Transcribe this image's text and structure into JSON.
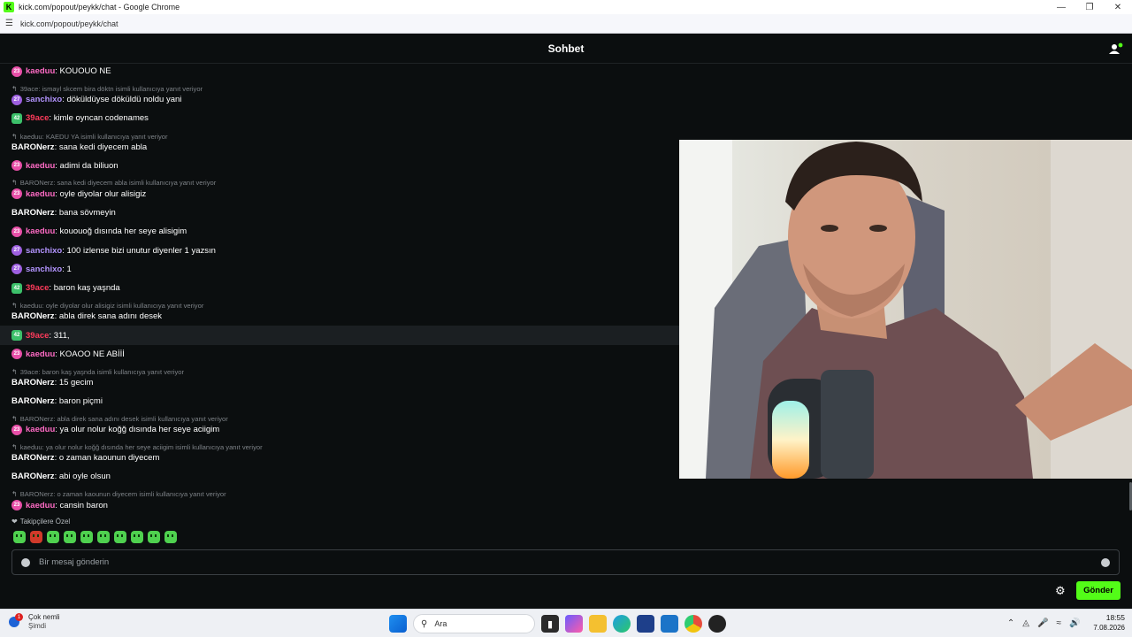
{
  "browser": {
    "window_title": "kick.com/popout/peykk/chat - Google Chrome",
    "url": "kick.com/popout/peykk/chat",
    "favicon_letter": "K"
  },
  "header": {
    "title": "Sohbet"
  },
  "messages": [
    {
      "badge": "23",
      "badge_color": "pink",
      "user": "kaeduu",
      "user_color": "pink",
      "text": ": KOUOUO NE",
      "reply": ""
    },
    {
      "badge": "27",
      "badge_color": "purple",
      "user": "sanchixo",
      "user_color": "purple",
      "text": ": döküldüyse döküldü noldu yani",
      "reply": "39ace: ismayl skcem bira döktn isimli kullanıcıya yanıt veriyor"
    },
    {
      "badge": "42",
      "badge_color": "green",
      "user": "39ace",
      "user_color": "red",
      "text": ": kimle oyncan codenames",
      "reply": ""
    },
    {
      "badge": "",
      "badge_color": "",
      "user": "BARONerz",
      "user_color": "white",
      "text": ": sana kedi diyecem abla",
      "reply": "kaeduu: KAEDU YA isimli kullanıcıya yanıt veriyor"
    },
    {
      "badge": "23",
      "badge_color": "pink",
      "user": "kaeduu",
      "user_color": "pink",
      "text": ": adimi da biliuon",
      "reply": ""
    },
    {
      "badge": "23",
      "badge_color": "pink",
      "user": "kaeduu",
      "user_color": "pink",
      "text": ": oyle diyolar olur alisigiz",
      "reply": "BARONerz: sana kedi diyecem abla isimli kullanıcıya yanıt veriyor"
    },
    {
      "badge": "",
      "badge_color": "",
      "user": "BARONerz",
      "user_color": "white",
      "text": ": bana sövmeyin",
      "reply": ""
    },
    {
      "badge": "23",
      "badge_color": "pink",
      "user": "kaeduu",
      "user_color": "pink",
      "text": ": kououoğ dısında her seye alisigim",
      "reply": ""
    },
    {
      "badge": "27",
      "badge_color": "purple",
      "user": "sanchixo",
      "user_color": "purple",
      "text": ": 100 izlense bizi unutur diyenler 1 yazsın",
      "reply": ""
    },
    {
      "badge": "27",
      "badge_color": "purple",
      "user": "sanchixo",
      "user_color": "purple",
      "text": ": 1",
      "reply": ""
    },
    {
      "badge": "42",
      "badge_color": "green",
      "user": "39ace",
      "user_color": "red",
      "text": ": baron kaş yaşnda",
      "reply": ""
    },
    {
      "badge": "",
      "badge_color": "",
      "user": "BARONerz",
      "user_color": "white",
      "text": ": abla direk sana adını desek",
      "reply": "kaeduu: oyle diyolar olur alisigiz isimli kullanıcıya yanıt veriyor"
    },
    {
      "badge": "42",
      "badge_color": "green",
      "user": "39ace",
      "user_color": "red",
      "text": ": 311,",
      "reply": "",
      "highlight": true
    },
    {
      "badge": "23",
      "badge_color": "pink",
      "user": "kaeduu",
      "user_color": "pink",
      "text": ": KOAOO NE ABİİİ",
      "reply": ""
    },
    {
      "badge": "",
      "badge_color": "",
      "user": "BARONerz",
      "user_color": "white",
      "text": ": 15 gecim",
      "reply": "39ace: baron kaş yaşnda isimli kullanıcıya yanıt veriyor"
    },
    {
      "badge": "",
      "badge_color": "",
      "user": "BARONerz",
      "user_color": "white",
      "text": ": baron piçmi",
      "reply": ""
    },
    {
      "badge": "23",
      "badge_color": "pink",
      "user": "kaeduu",
      "user_color": "pink",
      "text": ": ya olur nolur koğğ dısında her seye aciigim",
      "reply": "BARONerz: abla direk sana adını desek isimli kullanıcıya yanıt veriyor"
    },
    {
      "badge": "",
      "badge_color": "",
      "user": "BARONerz",
      "user_color": "white",
      "text": ": o zaman kaounun diyecem",
      "reply": "kaeduu: ya olur nolur koğğ dısında her seye aciigim isimli kullanıcıya yanıt veriyor"
    },
    {
      "badge": "",
      "badge_color": "",
      "user": "BARONerz",
      "user_color": "white",
      "text": ": abi oyle olsun",
      "reply": ""
    },
    {
      "badge": "23",
      "badge_color": "pink",
      "user": "kaeduu",
      "user_color": "pink",
      "text": ": cansin baron",
      "reply": "BARONerz: o zaman kaounun diyecem isimli kullanıcıya yanıt veriyor"
    }
  ],
  "followers_only": "Takipçilere Özel",
  "emotes_count": 10,
  "input": {
    "placeholder": "Bir mesaj gönderin"
  },
  "send_label": "Gönder",
  "taskbar": {
    "weather_title": "Çok nemli",
    "weather_sub": "Şimdi",
    "notification_count": "1",
    "search_label": "Ara",
    "time": "18:55",
    "date": "7.08.2026"
  },
  "colors": {
    "accent": "#53fc18",
    "background": "#0b0e0f"
  }
}
